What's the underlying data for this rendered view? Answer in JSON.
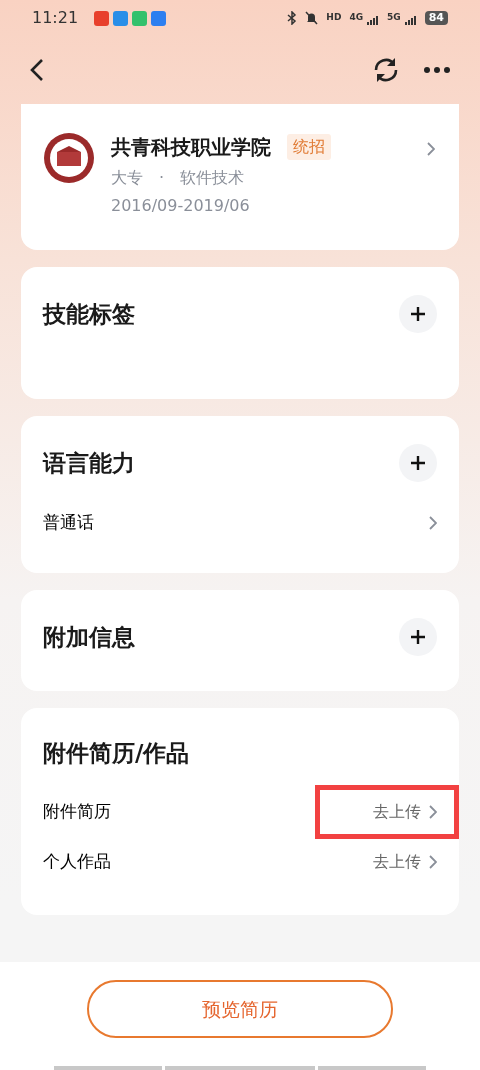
{
  "status_bar": {
    "time": "11:21",
    "network_labels": [
      "HD",
      "4G",
      "5G"
    ],
    "battery": "84"
  },
  "education": {
    "school": "共青科技职业学院",
    "tag": "统招",
    "degree": "大专",
    "separator": "·",
    "major": "软件技术",
    "period": "2016/09-2019/06"
  },
  "sections": [
    {
      "title": "技能标签",
      "kind": "add"
    },
    {
      "title": "语言能力",
      "kind": "add",
      "items": [
        {
          "label": "普通话",
          "highlighted": false
        }
      ]
    },
    {
      "title": "附加信息",
      "kind": "add"
    },
    {
      "title": "附件简历/作品",
      "kind": "plain",
      "items": [
        {
          "label": "附件简历",
          "action": "去上传",
          "highlighted": true
        },
        {
          "label": "个人作品",
          "action": "去上传",
          "highlighted": false
        }
      ]
    }
  ],
  "preview_button": "预览简历"
}
